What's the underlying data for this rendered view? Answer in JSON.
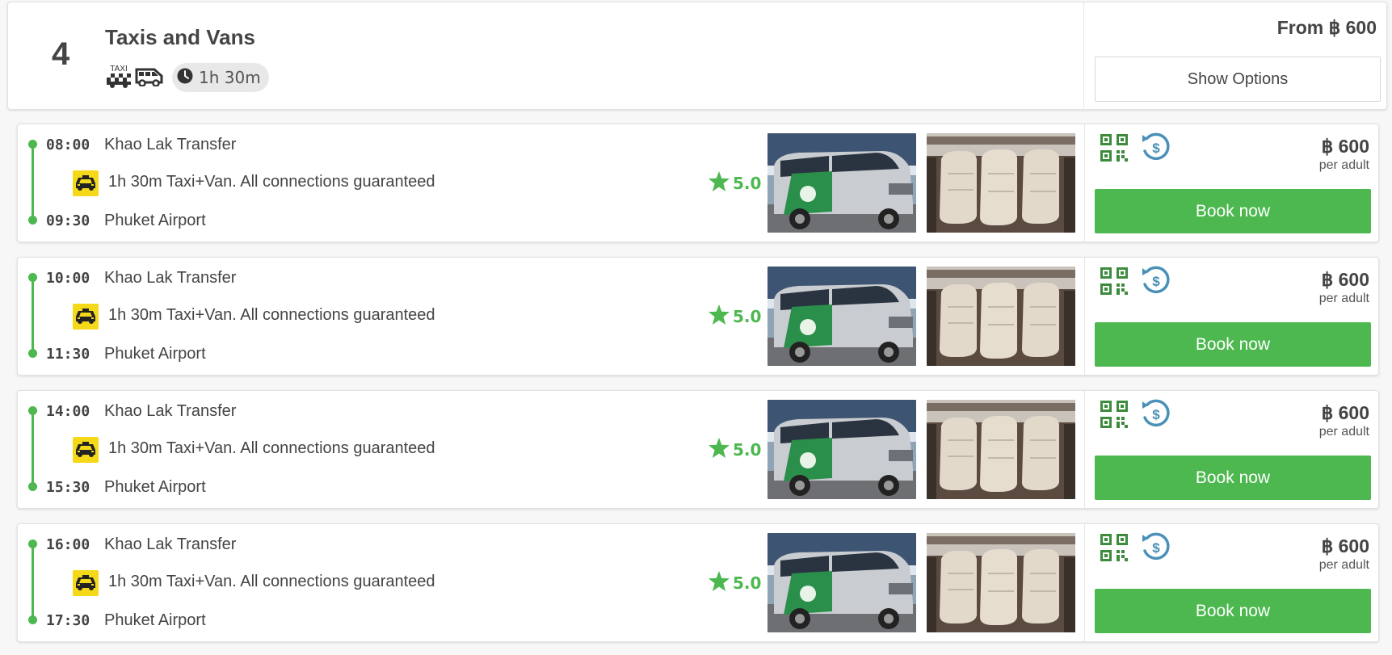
{
  "summary": {
    "count": "4",
    "title": "Taxis and Vans",
    "taxi_icon_label": "TAXI",
    "duration": "1h 30m",
    "from_price": "From ฿ 600",
    "show_options_label": "Show Options",
    "icons": [
      "taxi-icon",
      "van-icon",
      "clock-icon"
    ]
  },
  "trips": [
    {
      "depart_time": "08:00",
      "origin": "Khao Lak Transfer",
      "description": "1h 30m Taxi+Van. All connections guaranteed",
      "arrive_time": "09:30",
      "destination": "Phuket Airport",
      "rating": "5.0",
      "price": "฿ 600",
      "price_unit": "per adult",
      "book_label": "Book now"
    },
    {
      "depart_time": "10:00",
      "origin": "Khao Lak Transfer",
      "description": "1h 30m Taxi+Van. All connections guaranteed",
      "arrive_time": "11:30",
      "destination": "Phuket Airport",
      "rating": "5.0",
      "price": "฿ 600",
      "price_unit": "per adult",
      "book_label": "Book now"
    },
    {
      "depart_time": "14:00",
      "origin": "Khao Lak Transfer",
      "description": "1h 30m Taxi+Van. All connections guaranteed",
      "arrive_time": "15:30",
      "destination": "Phuket Airport",
      "rating": "5.0",
      "price": "฿ 600",
      "price_unit": "per adult",
      "book_label": "Book now"
    },
    {
      "depart_time": "16:00",
      "origin": "Khao Lak Transfer",
      "description": "1h 30m Taxi+Van. All connections guaranteed",
      "arrive_time": "17:30",
      "destination": "Phuket Airport",
      "rating": "5.0",
      "price": "฿ 600",
      "price_unit": "per adult",
      "book_label": "Book now"
    }
  ],
  "trip_icons": [
    "taxi-icon",
    "star-icon",
    "van-exterior-photo",
    "van-interior-photo",
    "qr-code-icon",
    "refund-icon"
  ],
  "colors": {
    "accent_green": "#4cb84f",
    "taxi_yellow": "#f5d817",
    "qr_green": "#3d8b3d",
    "refund_blue": "#4a90b8",
    "text": "#444444"
  }
}
